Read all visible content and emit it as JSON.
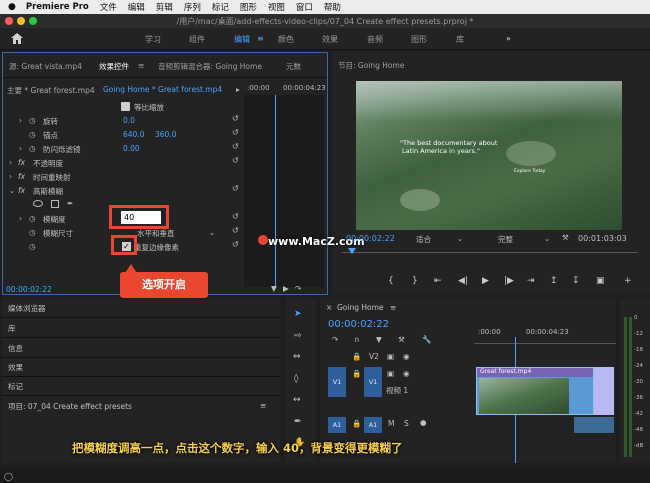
{
  "menubar": {
    "apple": "",
    "app_name": "Premiere Pro",
    "items": [
      "文件",
      "编辑",
      "剪辑",
      "序列",
      "标记",
      "图形",
      "视图",
      "窗口",
      "帮助"
    ]
  },
  "titlebar": {
    "title": "/用户/mac/桌面/add-effects-video-clips/07_04 Create effect presets.prproj *"
  },
  "workspaces": {
    "home_icon": "home-icon",
    "items": [
      "学习",
      "组件",
      "编辑",
      "颜色",
      "效果",
      "音频",
      "图形",
      "库"
    ],
    "active": "编辑",
    "more": "»"
  },
  "source_panel": {
    "tab_source": "源: Great vista.mp4",
    "tab_effect_controls": "效果控件",
    "tab_audio_mixer": "音频剪辑混合器: Going Home",
    "tab_meta": "元数",
    "master_label": "主要 * Great forest.mp4",
    "sequence_label": "Going Home * Great forest.mp4",
    "ruler_start": ":00:00",
    "ruler_end": "00:00:04:23",
    "uniform_scale": "等比缩放",
    "rows": [
      {
        "name": "旋转",
        "value": "0.0"
      },
      {
        "name": "锚点",
        "value": "640.0",
        "value2": "360.0"
      },
      {
        "name": "防闪烁滤镜",
        "value": "0.00"
      }
    ],
    "fx_opacity": "不透明度",
    "fx_time_remap": "时间重映射",
    "fx_blur": "高斯模糊",
    "blurriness_label": "模糊度",
    "blurriness_value": "40",
    "blur_dimensions_label": "模糊尺寸",
    "blur_dimensions_value": "水平和垂直",
    "repeat_edge_label": "重复边缘像素",
    "timecode": "00:00:02:22"
  },
  "callout": {
    "text": "选项开启"
  },
  "program_monitor": {
    "title": "节目: Going Home",
    "overlay_text_1": "\"The best documentary about",
    "overlay_text_2": "Latin America in years.\"",
    "overlay_text_3": "Explore Today",
    "watermark": "www.MacZ.com",
    "timecode": "00:00:02:22",
    "fit": "适合",
    "quality": "完整",
    "duration": "00:01:03:03"
  },
  "project_panel": {
    "items": [
      "媒体浏览器",
      "库",
      "信息",
      "效果",
      "标记"
    ],
    "project_label": "项目: 07_04 Create effect presets"
  },
  "timeline": {
    "title": "Going Home",
    "timecode": "00:00:02:22",
    "ruler_start": ":00:00",
    "ruler_end": "00:00:04:23",
    "tracks": [
      {
        "id": "V2",
        "label": ""
      },
      {
        "id": "V1",
        "label": "视频 1"
      },
      {
        "id": "A1",
        "label": ""
      }
    ],
    "v1_target": "V1",
    "a1_target": "A1",
    "clip_name": "Great forest.mp4",
    "meter_marks": [
      "0",
      "-12",
      "-18",
      "-24",
      "-30",
      "-36",
      "-42",
      "-48",
      "-dB"
    ]
  },
  "subtitle": {
    "text": "把模糊度调高一点，点击这个数字，输入 40，背景变得更模糊了"
  },
  "colors": {
    "accent": "#4aa3ff",
    "highlight": "#e8462e",
    "subtitle": "#f5d04a"
  }
}
